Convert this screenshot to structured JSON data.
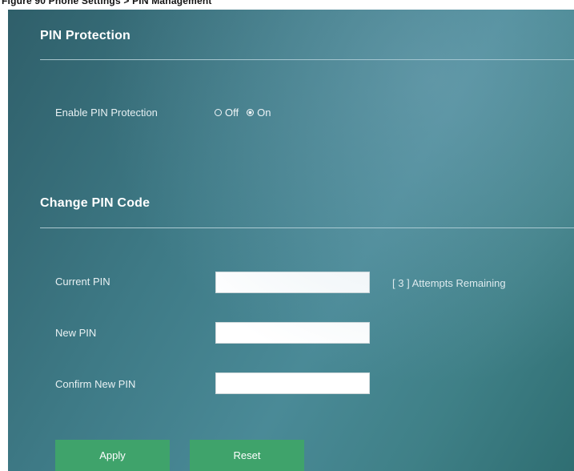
{
  "figure_caption": "Figure 90   Phone Settings > PIN Management",
  "pin_protection": {
    "title": "PIN Protection",
    "enable_label": "Enable PIN Protection",
    "options": [
      "Off",
      "On"
    ],
    "selected": "On"
  },
  "change_pin": {
    "title": "Change PIN Code",
    "current_pin_label": "Current PIN",
    "current_pin_value": "",
    "attempts_text": "[ 3 ] Attempts Remaining",
    "new_pin_label": "New PIN",
    "new_pin_value": "",
    "confirm_pin_label": "Confirm New PIN",
    "confirm_pin_value": ""
  },
  "buttons": {
    "apply": "Apply",
    "reset": "Reset"
  },
  "colors": {
    "panel_bg": "#3e7a86",
    "button_green": "#3fa36b"
  }
}
